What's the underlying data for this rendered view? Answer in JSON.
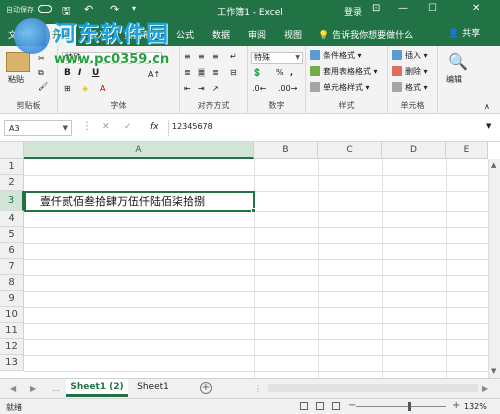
{
  "titlebar": {
    "autosave_label": "自动保存",
    "save_icon": "save-icon",
    "undo_icon": "undo-icon",
    "redo_icon": "redo-icon",
    "title": "工作簿1 - Excel",
    "login": "登录",
    "minimize": "—",
    "restore": "☐",
    "close": "✕"
  },
  "menubar": {
    "tabs": [
      "文件",
      "插入",
      "页面布局",
      "公式",
      "数据",
      "审阅",
      "视图"
    ],
    "active_tab": "开始",
    "tell_me": "告诉我你想要做什么",
    "share": "共享"
  },
  "watermark": {
    "line1": "河东软件园",
    "line2": "www.pc0359.cn"
  },
  "ribbon": {
    "clipboard": {
      "paste": "粘贴",
      "group": "剪贴板"
    },
    "font": {
      "name": "特殊",
      "group": "字体",
      "bold": "B",
      "italic": "I",
      "underline": "U"
    },
    "alignment": {
      "group": "对齐方式"
    },
    "number": {
      "format": "特殊",
      "percent": "%",
      "comma": ",",
      "group": "数字"
    },
    "styles": {
      "conditional": "条件格式",
      "table": "套用表格格式",
      "cell_styles": "单元格样式",
      "group": "样式"
    },
    "cells": {
      "insert": "插入",
      "delete": "删除",
      "format": "格式",
      "group": "单元格"
    },
    "editing": {
      "label": "编辑"
    }
  },
  "formula_bar": {
    "name_box": "A3",
    "cancel": "✕",
    "enter": "✓",
    "fx": "fx",
    "value": "12345678"
  },
  "grid": {
    "columns": [
      "A",
      "B",
      "C",
      "D",
      "E"
    ],
    "selected_column": "A",
    "rows": [
      "1",
      "2",
      "3",
      "4",
      "5",
      "6",
      "7",
      "8",
      "9",
      "10",
      "11",
      "12",
      "13"
    ],
    "selected_row": "3",
    "active_cell": "A3",
    "active_cell_display": "壹仟贰佰叁拾肆万伍仟陆佰柒拾捌"
  },
  "sheets": {
    "tabs": [
      "Sheet1 (2)",
      "Sheet1"
    ],
    "active": "Sheet1 (2)",
    "add": "+"
  },
  "status": {
    "ready": "就绪",
    "zoom_out": "−",
    "zoom_in": "+",
    "zoom_level": "132%"
  },
  "colors": {
    "accent": "#217346",
    "ribbon_bg": "#f3f3f3",
    "header_bg": "#f0f0f0"
  }
}
